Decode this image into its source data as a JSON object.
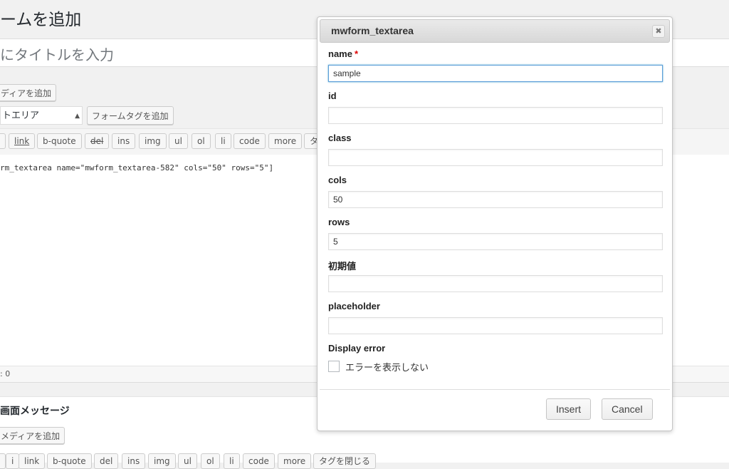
{
  "background": {
    "page_title": "ームを追加",
    "title_placeholder": "にタイトルを入力",
    "add_media": "ディアを追加",
    "tag_select": "トエリア",
    "add_form_tag": "フォームタグを追加",
    "quicktags": [
      "",
      "link",
      "b-quote",
      "del",
      "ins",
      "img",
      "ul",
      "ol",
      "li",
      "code",
      "more",
      "タ"
    ],
    "editor_content": "rm_textarea name=\"mwform_textarea-582\" cols=\"50\" rows=\"5\"]",
    "status": ": 0",
    "section2_title": "画面メッセージ",
    "section2_add_media": "メディアを追加",
    "quicktags2": [
      "",
      "i",
      "link",
      "b-quote",
      "del",
      "ins",
      "img",
      "ul",
      "ol",
      "li",
      "code",
      "more",
      "タグを閉じる"
    ]
  },
  "dialog": {
    "title": "mwform_textarea",
    "close_icon": "close-icon",
    "fields": {
      "name": {
        "label": "name",
        "required_mark": "*",
        "value": "sample"
      },
      "id": {
        "label": "id",
        "value": ""
      },
      "class": {
        "label": "class",
        "value": ""
      },
      "cols": {
        "label": "cols",
        "value": "50"
      },
      "rows": {
        "label": "rows",
        "value": "5"
      },
      "initial": {
        "label": "初期値",
        "value": ""
      },
      "placeholder": {
        "label": "placeholder",
        "value": ""
      }
    },
    "display_error": {
      "label": "Display error",
      "checkbox_label": "エラーを表示しない",
      "checked": false
    },
    "insert_label": "Insert",
    "cancel_label": "Cancel"
  },
  "colors": {
    "focus_border": "#5b9dd9",
    "required": "#dd0000",
    "dialog_bg": "#ffffff"
  }
}
